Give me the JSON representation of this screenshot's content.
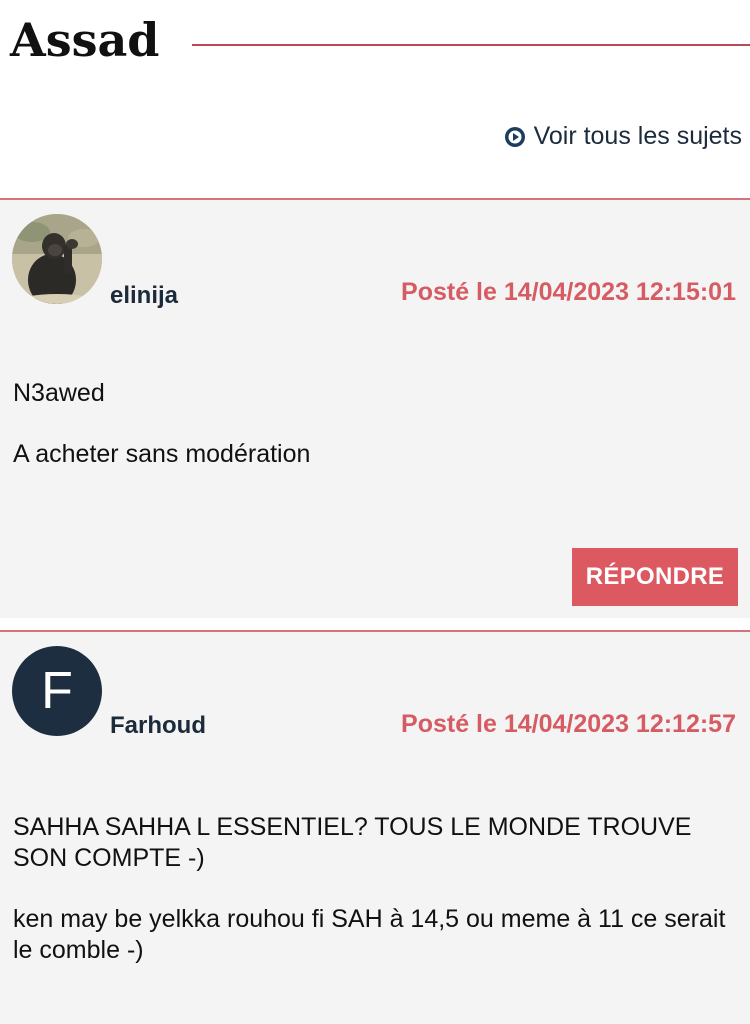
{
  "header": {
    "title": "Assad",
    "see_all_label": "Voir tous les sujets",
    "see_all_icon": "play-circle-icon"
  },
  "posts": [
    {
      "author": "elinija",
      "avatar_type": "photo",
      "date": "Posté le 14/04/2023 12:15:01",
      "paragraphs": [
        "N3awed",
        "A acheter sans modération"
      ],
      "reply_label": "RÉPONDRE"
    },
    {
      "author": "Farhoud",
      "avatar_type": "initial",
      "avatar_initial": "F",
      "date": "Posté le 14/04/2023 12:12:57",
      "paragraphs": [
        "SAHHA SAHHA L ESSENTIEL? TOUS LE MONDE TROUVE SON COMPTE -)",
        "ken may be yelkka rouhou fi SAH à 14,5 ou meme à 11 ce serait le comble -)"
      ]
    }
  ],
  "colors": {
    "accent": "#dc5962",
    "rule": "#b84b55",
    "navy": "#1d2e40",
    "post_bg": "#f4f4f4"
  }
}
